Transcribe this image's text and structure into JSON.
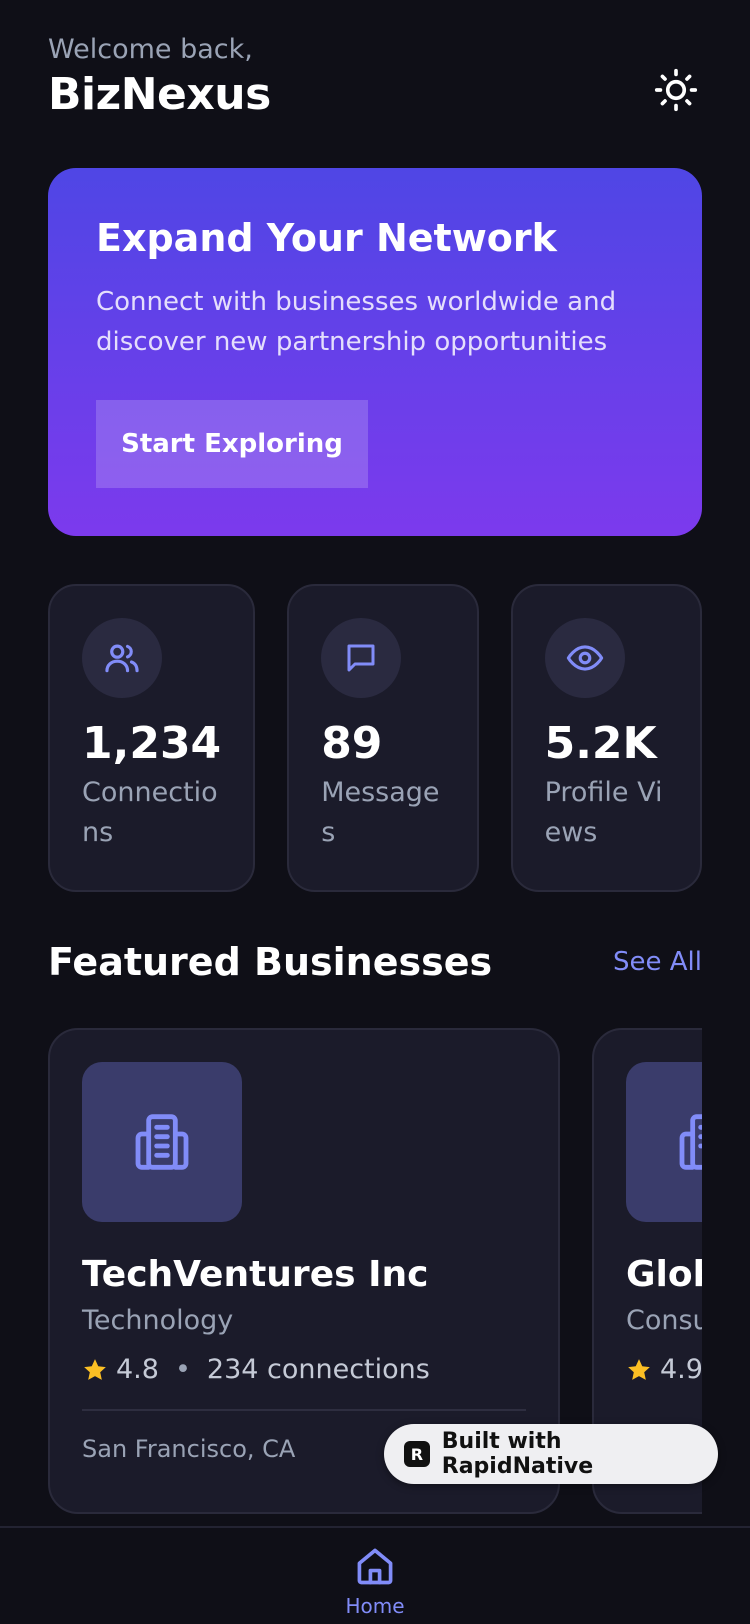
{
  "header": {
    "welcome": "Welcome back,",
    "brand": "BizNexus",
    "theme_icon": "sun-icon"
  },
  "hero": {
    "title": "Expand Your Network",
    "subtitle": "Connect with businesses worldwide and discover new partnership opportunities",
    "button_label": "Start Exploring"
  },
  "stats": [
    {
      "icon": "users-icon",
      "value": "1,234",
      "label": "Connections"
    },
    {
      "icon": "message-icon",
      "value": "89",
      "label": "Messages"
    },
    {
      "icon": "eye-icon",
      "value": "5.2K",
      "label": "Profile Views"
    }
  ],
  "featured": {
    "title": "Featured Businesses",
    "see_all": "See All",
    "businesses": [
      {
        "name": "TechVentures Inc",
        "category": "Technology",
        "rating": "4.8",
        "connections": "234 connections",
        "location": "San Francisco, CA"
      },
      {
        "name": "Glob",
        "category": "Consu",
        "rating": "4.9",
        "connections": "",
        "location": ""
      }
    ]
  },
  "badge": {
    "label": "Built with RapidNative"
  },
  "tabbar": {
    "home_label": "Home"
  },
  "colors": {
    "accent": "#818cf8",
    "hero_start": "#4f46e5",
    "hero_end": "#7c3aed",
    "star": "#fbbf24"
  }
}
